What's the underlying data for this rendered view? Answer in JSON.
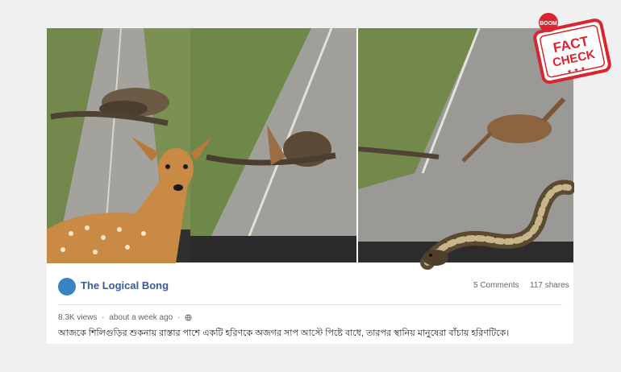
{
  "post": {
    "page_name": "The Logical Bong",
    "comments": "5 Comments",
    "shares": "117 shares",
    "views": "8.3K views",
    "separator": "·",
    "time": "about a week ago",
    "separator2": "·",
    "caption": "আজকে শিলিগুড়ির শুকনায় রাস্তার পাশে একটি হরিণকে অজগর সাপ আস্টে পিষ্টে বাধে, তারপর স্থানিয় মানুষেরা বাঁচায় হরিণটিকে।"
  },
  "stamp": {
    "brand": "BOOM",
    "line1": "FACT",
    "line2": "CHECK",
    "stars": "★ ★ ★"
  },
  "colors": {
    "page_name": "#3b5998",
    "stamp_red": "#d7262f",
    "road": "#9a9a96",
    "grass": "#6f8a4a"
  }
}
